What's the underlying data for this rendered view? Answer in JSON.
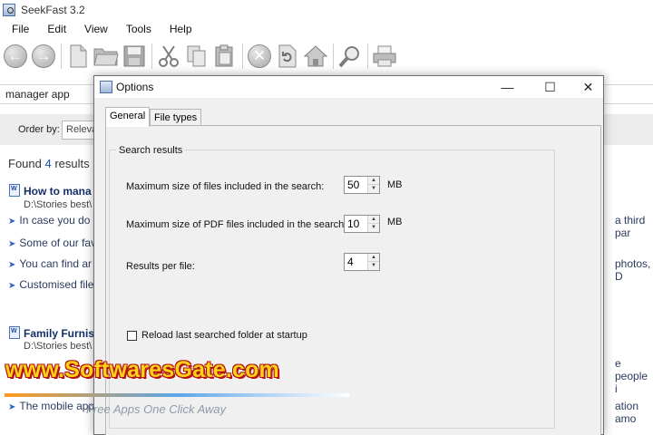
{
  "app": {
    "title": "SeekFast 3.2"
  },
  "menu": [
    "File",
    "Edit",
    "View",
    "Tools",
    "Help"
  ],
  "toolbar": {
    "buttons": [
      "back",
      "forward",
      "new",
      "open",
      "save",
      "cut",
      "copy",
      "paste",
      "stop",
      "refresh",
      "home",
      "find",
      "print"
    ]
  },
  "search": {
    "value": "manager app"
  },
  "order": {
    "label": "Order by:",
    "value": "Releva"
  },
  "results": {
    "found_prefix": "Found ",
    "found_count": "4",
    "found_suffix": " results i",
    "items": [
      {
        "title": "How to mana",
        "path": "D:\\Stories best\\",
        "snippets": [
          "In case you do",
          "Some of our fav",
          "You can find ar",
          "Customised file"
        ]
      },
      {
        "title": "Family Furnis",
        "path": "D:\\Stories best\\",
        "snippets": [
          "The mobile app"
        ]
      }
    ],
    "right_snippets": [
      "a third par",
      "photos, D",
      "e people i",
      "ation amo"
    ]
  },
  "watermark": {
    "main": "www.SoftwaresGate.com",
    "tagline": "Free Apps One Click Away"
  },
  "dialog": {
    "title": "Options",
    "minimize": "—",
    "maximize": "☐",
    "close": "✕",
    "tabs": [
      "General",
      "File types"
    ],
    "group_title": "Search results",
    "fields": [
      {
        "label": "Maximum size of files included in the search:",
        "value": "50",
        "unit": "MB"
      },
      {
        "label": "Maximum size of PDF files included in the search:",
        "value": "10",
        "unit": "MB"
      },
      {
        "label": "Results per file:",
        "value": "4",
        "unit": ""
      }
    ],
    "checkbox_label": "Reload last searched folder at startup",
    "checkbox_checked": false
  }
}
